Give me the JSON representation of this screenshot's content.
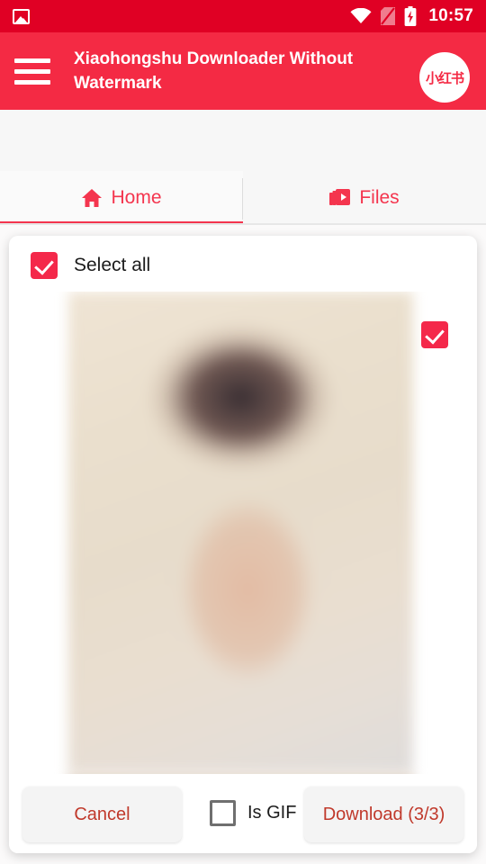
{
  "status_bar": {
    "left_icon": "photo-icon",
    "wifi_icon": "wifi-icon",
    "sim_icon": "no-sim-icon",
    "battery_icon": "battery-charging-icon",
    "clock": "10:57",
    "background_color": "#e00024"
  },
  "app_bar": {
    "menu_icon": "hamburger-menu-icon",
    "title": "Xiaohongshu Downloader Without Watermark",
    "logo_text": "小红书",
    "background_color": "#f42a44"
  },
  "tabs": [
    {
      "label": "Home",
      "icon": "home-icon",
      "active": true
    },
    {
      "label": "Files",
      "icon": "video-library-icon",
      "active": false
    }
  ],
  "dialog": {
    "select_all": {
      "label": "Select all",
      "checked": true
    },
    "items": [
      {
        "name": "image-thumbnail-1",
        "checked": true
      },
      {
        "name": "image-thumbnail-2",
        "checked": false
      }
    ],
    "actions": {
      "cancel_label": "Cancel",
      "gif_label": "Is GIF",
      "gif_checked": false,
      "download_label": "Download (3/3)"
    }
  },
  "colors": {
    "accent": "#f4284a",
    "app_bar": "#f42a44",
    "status_bar": "#e00024",
    "button_text": "#c0392b",
    "tab_text": "#f4354e"
  }
}
